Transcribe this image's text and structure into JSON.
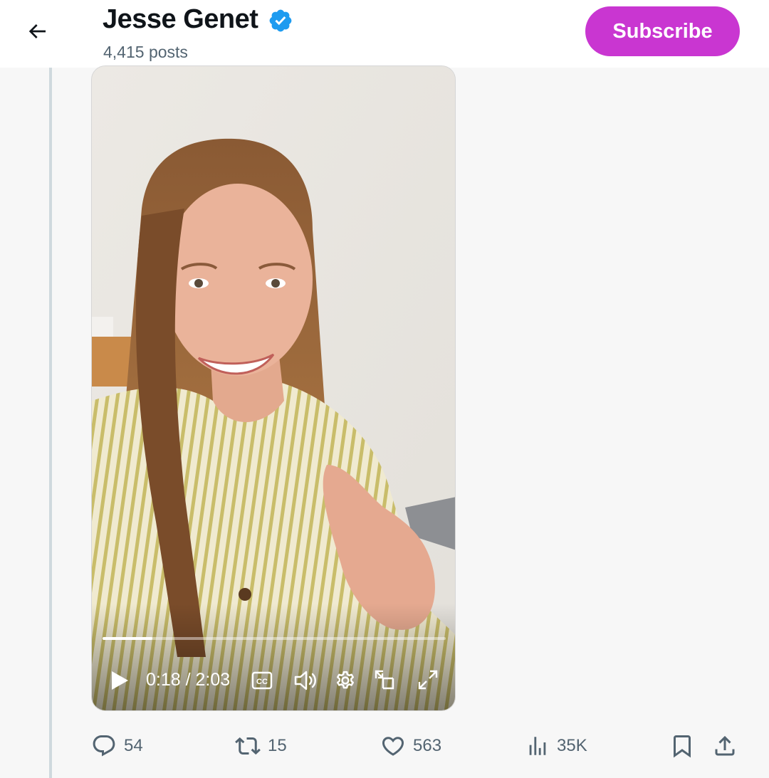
{
  "header": {
    "name": "Jesse Genet",
    "posts": "4,415 posts",
    "subscribe_label": "Subscribe",
    "verified": true
  },
  "video": {
    "current_time": "0:18",
    "duration": "2:03",
    "time_display": "0:18 / 2:03",
    "progress_fraction": 0.146
  },
  "actions": {
    "replies": "54",
    "reposts": "15",
    "likes": "563",
    "views": "35K"
  },
  "colors": {
    "accent": "#c936d1",
    "verified": "#1d9bf0",
    "muted": "#536471"
  },
  "icons": [
    "back-arrow-icon",
    "verified-badge-icon",
    "play-icon",
    "captions-icon",
    "volume-icon",
    "settings-icon",
    "pip-icon",
    "fullscreen-icon",
    "reply-icon",
    "repost-icon",
    "like-icon",
    "views-icon",
    "bookmark-icon",
    "share-icon"
  ]
}
